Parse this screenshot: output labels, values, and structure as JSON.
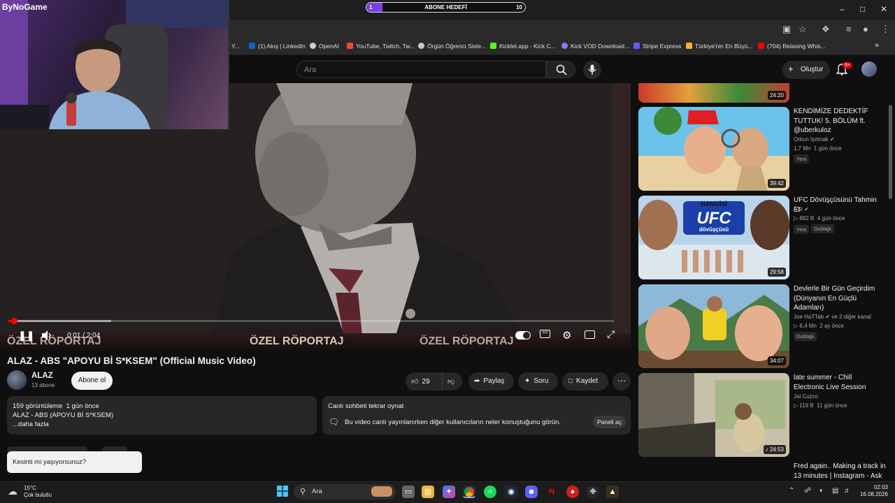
{
  "stream_overlay": {
    "webcam_label": "ByNoGame",
    "goal_left": "1",
    "goal_label": "ABONE HEDEFİ",
    "goal_right": "10",
    "goal_progress": 0.1
  },
  "browser": {
    "bookmarks": [
      {
        "label": "Y...",
        "color": "#ff4444"
      },
      {
        "label": "(1) Akış | LinkedIn",
        "color": "#0a66c2"
      },
      {
        "label": "OpenAI",
        "color": "#d0d0d0"
      },
      {
        "label": "YouTube, Twitch, Tw...",
        "color": "#e84a2f"
      },
      {
        "label": "Örgün Öğrenci Siste...",
        "color": "#c8c8c8"
      },
      {
        "label": "Kicklet.app - Kick C...",
        "color": "#53fc18"
      },
      {
        "label": "Kick VOD Download...",
        "color": "#8a7cf0"
      },
      {
        "label": "Stripe Express",
        "color": "#635bff"
      },
      {
        "label": "Türkiye'nin En Büyü...",
        "color": "#f2b134"
      },
      {
        "label": "(704) Relaxing Whis...",
        "color": "#ff0000"
      }
    ]
  },
  "youtube": {
    "search_placeholder": "Ara",
    "create_label": "Oluştur",
    "notifications_count": "9+"
  },
  "player": {
    "banner_text": "ÖZEL RÖPORTAJ",
    "time_display": "0:01 / 2:04",
    "progress_fraction": 0.008
  },
  "video": {
    "title": "ALAZ - ABS \"APOYU Bİ S*KSEM\" (Official Music Video)",
    "channel_name": "ALAZ",
    "channel_subs": "13 abone",
    "subscribe_label": "Abone ol",
    "like_count": "29",
    "share_label": "Paylaş",
    "ask_label": "Soru",
    "save_label": "Kaydet",
    "description": {
      "views": "159 görüntüleme",
      "age": "1 gün önce",
      "text": "ALAZ - ABS (APOYU Bİ S*KSEM)",
      "more": "...daha fazla"
    },
    "chat": {
      "title": "Canlı sohbeti tekrar oynat",
      "info": "Bu video canlı yayınlanırken diğer kullanıcıların neler konuştuğunu görün.",
      "open_label": "Paneli aç"
    },
    "toast": "Kesinti mi yaşıyorsunuz?"
  },
  "related": [
    {
      "title": "",
      "channel": "",
      "views": "",
      "age": "",
      "duration": "24:20"
    },
    {
      "title": "KENDİMİZE DEDEKTİF TUTTUK! 5. BÖLÜM ft. @uberkuloz",
      "channel": "Orkun Işıtmak",
      "views": "1,7 Mn",
      "age": "1 gün önce",
      "duration": "39:42",
      "badges": [
        "Yeni"
      ]
    },
    {
      "title": "UFC Dövüşçüsünü Tahmin Et",
      "channel": "KSI",
      "views": "882 B",
      "age": "4 gün önce",
      "duration": "29:58",
      "badges": [
        "Yeni",
        "Dublajlı"
      ]
    },
    {
      "title": "Devlerle Bir Gün Geçirdim (Dünyanın En Güçlü Adamları)",
      "channel": "Joe HaTTab",
      "channel_extra": "ve 2 diğer kanal",
      "views": "6,4 Mn",
      "age": "2 ay önce",
      "duration": "34:07",
      "badges": [
        "Dublajlı"
      ]
    },
    {
      "title": "late summer - Chill Electronic Live Session",
      "channel": "Jai Cuzco",
      "views": "119 B",
      "age": "11 gün önce",
      "duration": "24:53"
    },
    {
      "title": "Fred again.. Making a track in 13 minutes | Instagram - Ask"
    }
  ],
  "thumb_text": {
    "ufc_top": "HANGİSİ",
    "ufc_main": "UFC",
    "ufc_sub": "dövüşçüsü"
  },
  "taskbar": {
    "temperature": "15°C",
    "weather": "Çok bulutlu",
    "search_label": "Ara",
    "time": "02:03",
    "date": "16.08.2026"
  }
}
